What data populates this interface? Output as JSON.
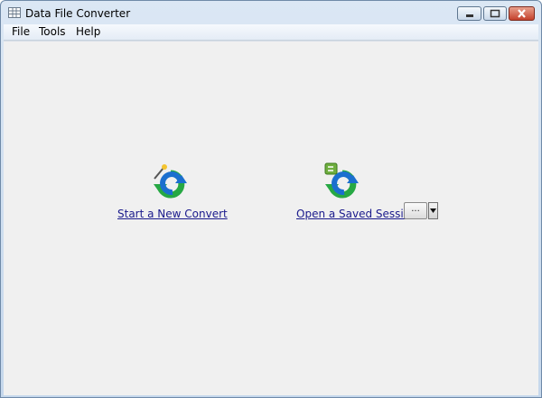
{
  "window": {
    "title": "Data File Converter"
  },
  "menu": {
    "items": [
      "File",
      "Tools",
      "Help"
    ]
  },
  "actions": {
    "new_convert_label": "Start a New Convert",
    "open_session_label": "Open a Saved Session",
    "browse_label": "..."
  },
  "icons": {
    "app": "spreadsheet-icon",
    "new_convert": "convert-wand-icon",
    "open_session": "convert-session-icon",
    "minimize": "minimize-icon",
    "maximize": "maximize-icon",
    "close": "close-icon",
    "dropdown": "chevron-down-icon"
  },
  "colors": {
    "link": "#1a1a8c",
    "client_bg": "#f0f0f0",
    "close_button": "#c4412c",
    "convert_blue": "#1b6fcf",
    "convert_green": "#27a844"
  }
}
